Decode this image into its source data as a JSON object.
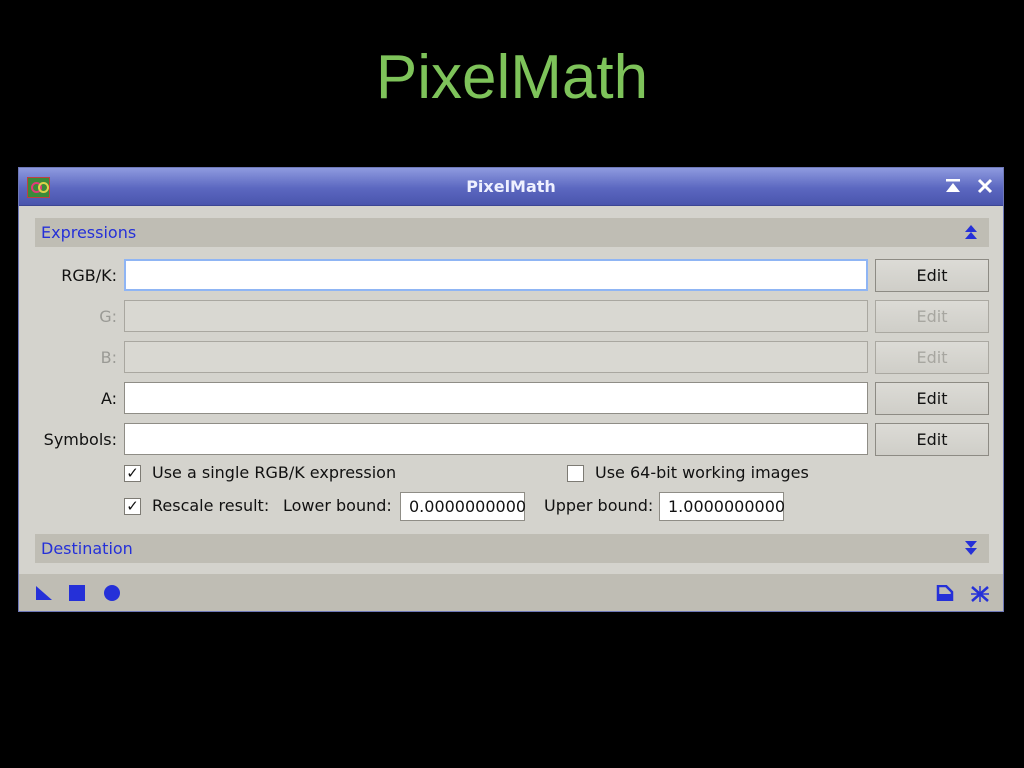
{
  "slide": {
    "title": "PixelMath"
  },
  "window": {
    "title": "PixelMath",
    "buttons": {
      "shade": "▲",
      "close": "✕"
    }
  },
  "sections": {
    "expressions": {
      "label": "Expressions",
      "toggle": "⮝"
    },
    "destination": {
      "label": "Destination",
      "toggle": "⮟"
    }
  },
  "expressions": {
    "rows": [
      {
        "label": "RGB/K:",
        "value": "",
        "edit": "Edit",
        "enabled": true
      },
      {
        "label": "G:",
        "value": "",
        "edit": "Edit",
        "enabled": false
      },
      {
        "label": "B:",
        "value": "",
        "edit": "Edit",
        "enabled": false
      },
      {
        "label": "A:",
        "value": "",
        "edit": "Edit",
        "enabled": true
      },
      {
        "label": "Symbols:",
        "value": "",
        "edit": "Edit",
        "enabled": true
      }
    ],
    "single_rgb": {
      "label": "Use a single RGB/K expression",
      "checked": true
    },
    "use_64bit": {
      "label": "Use 64-bit working images",
      "checked": false
    },
    "rescale": {
      "label": "Rescale result:",
      "checked": true
    },
    "lower_bound": {
      "label": "Lower bound:",
      "value": "0.0000000000"
    },
    "upper_bound": {
      "label": "Upper bound:",
      "value": "1.0000000000"
    }
  },
  "bottom_bar": {
    "left_icons": [
      "new-instance-icon",
      "apply-icon",
      "apply-global-icon"
    ],
    "right_icons": [
      "reset-icon",
      "preferences-icon"
    ]
  },
  "colors": {
    "title_green": "#7ec35a",
    "section_blue": "#2530d8",
    "titlebar": "#5b67c0"
  }
}
